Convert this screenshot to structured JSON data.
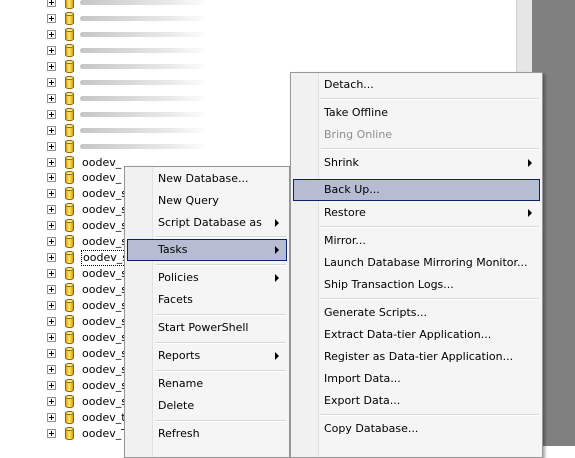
{
  "tree": {
    "rows": [
      {
        "label": ""
      },
      {
        "label": ""
      },
      {
        "label": ""
      },
      {
        "label": ""
      },
      {
        "label": ""
      },
      {
        "label": ""
      },
      {
        "label": ""
      },
      {
        "label": ""
      },
      {
        "label": ""
      },
      {
        "label": ""
      },
      {
        "label": "oodev_"
      },
      {
        "label": "oodev_"
      },
      {
        "label": "oodev_s"
      },
      {
        "label": "oodev_s"
      },
      {
        "label": "oodev_s"
      },
      {
        "label": "oodev_s"
      },
      {
        "label": "oodev_s"
      },
      {
        "label": "oodev_s"
      },
      {
        "label": "oodev_s"
      },
      {
        "label": "oodev_s"
      },
      {
        "label": "oodev_s"
      },
      {
        "label": "oodev_s"
      },
      {
        "label": "oodev_s"
      },
      {
        "label": "oodev_s"
      },
      {
        "label": "oodev_s"
      },
      {
        "label": "oodev_s"
      },
      {
        "label": "oodev_t"
      },
      {
        "label": "oodev_T"
      }
    ],
    "selected_index": 16
  },
  "context_menu": {
    "items": [
      {
        "label": "New Database..."
      },
      {
        "label": "New Query"
      },
      {
        "label": "Script Database as"
      },
      {
        "label": "Tasks"
      },
      {
        "label": "Policies"
      },
      {
        "label": "Facets"
      },
      {
        "label": "Start PowerShell"
      },
      {
        "label": "Reports"
      },
      {
        "label": "Rename"
      },
      {
        "label": "Delete"
      },
      {
        "label": "Refresh"
      }
    ]
  },
  "tasks_submenu": {
    "items": [
      {
        "label": "Detach..."
      },
      {
        "label": "Take Offline"
      },
      {
        "label": "Bring Online"
      },
      {
        "label": "Shrink"
      },
      {
        "label": "Back Up..."
      },
      {
        "label": "Restore"
      },
      {
        "label": "Mirror..."
      },
      {
        "label": "Launch Database Mirroring Monitor..."
      },
      {
        "label": "Ship Transaction Logs..."
      },
      {
        "label": "Generate Scripts..."
      },
      {
        "label": "Extract Data-tier Application..."
      },
      {
        "label": "Register as Data-tier Application..."
      },
      {
        "label": "Import Data..."
      },
      {
        "label": "Export Data..."
      },
      {
        "label": "Copy Database..."
      }
    ]
  },
  "colors": {
    "highlight": "#b6bdd2",
    "highlight_border": "#0a246a",
    "disabled_text": "#8d8d8d",
    "db_icon": "#e8c030"
  }
}
